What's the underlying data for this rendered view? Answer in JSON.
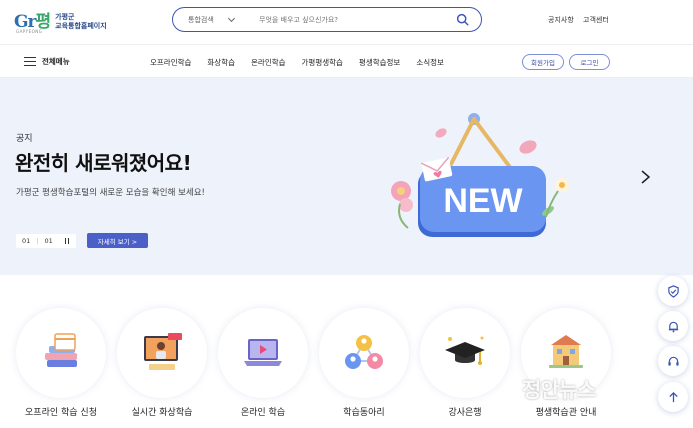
{
  "header": {
    "logo": {
      "mark": "Gr",
      "mark2": "평",
      "sub": "GAPYEONG",
      "line1": "가평군",
      "line2": "교육통합홈페이지"
    },
    "search": {
      "category": "통합검색",
      "placeholder": "무엇을 배우고 싶으신가요?"
    },
    "util_links": [
      "공지사항",
      "고객센터"
    ]
  },
  "nav": {
    "menu_label": "전체메뉴",
    "items": [
      "오프라인학습",
      "화상학습",
      "온라인학습",
      "가평평생학습",
      "평생학습정보",
      "소식정보"
    ],
    "signup": "회원가입",
    "login": "로그인"
  },
  "hero": {
    "kicker": "공지",
    "title": "완전히 새로워졌어요!",
    "desc": "가평군 평생학습포털의 새로운 모습을 확인해 보세요!",
    "pager_current": "01",
    "pager_total": "01",
    "more_label": "자세히 보기  >",
    "sign_text": "NEW"
  },
  "quick_menu": [
    {
      "label": "오프라인 학습 신청",
      "icon": "books-calendar-icon"
    },
    {
      "label": "실시간 화상학습",
      "icon": "live-class-icon"
    },
    {
      "label": "온라인 학습",
      "icon": "laptop-video-icon"
    },
    {
      "label": "학습동아리",
      "icon": "people-group-icon"
    },
    {
      "label": "강사은행",
      "icon": "graduation-cap-icon"
    },
    {
      "label": "평생학습관 안내",
      "icon": "building-icon"
    }
  ],
  "side_buttons": [
    "badge-icon",
    "bell-icon",
    "headset-icon",
    "arrow-up-icon"
  ],
  "watermark": "정안뉴스",
  "colors": {
    "accent": "#4b5fc9",
    "hero_bg": "#eef3fb",
    "sign": "#5b86e8"
  }
}
